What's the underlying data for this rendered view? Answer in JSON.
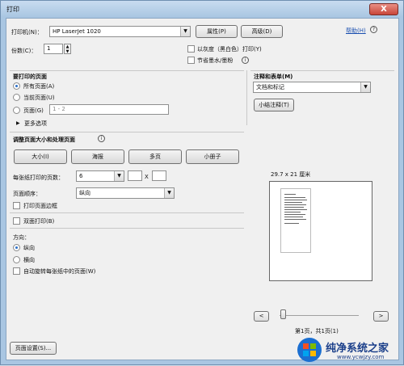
{
  "window": {
    "title": "打印",
    "close_label": "X"
  },
  "printer": {
    "label": "打印机(N)：",
    "selected": "HP LaserJet 1020",
    "properties_label": "属性(P)",
    "advanced_label": "高级(D)",
    "help_label": "帮助(H)",
    "help_icon": "?"
  },
  "copies": {
    "label": "份数(C)：",
    "value": "1"
  },
  "options": {
    "grayscale_label": "以灰度（黑白色）打印(Y)",
    "save_ink_label": "节省墨水/墨粉",
    "info_icon": "i"
  },
  "pages_section": {
    "title": "要打印的页面",
    "all_label": "所有页面(A)",
    "current_label": "当前页面(U)",
    "pages_label": "页面(G)",
    "pages_placeholder": "1 - 2",
    "more_label": "更多选项",
    "more_icon": "▶"
  },
  "comments_section": {
    "title": "注释和表单(M)",
    "selected": "文档和标记",
    "summarize_label": "小结注释(T)"
  },
  "sizing_section": {
    "title": "调整页面大小和处理页面",
    "info_icon": "i",
    "buttons": [
      "大小(I)",
      "海报",
      "多页",
      "小册子"
    ],
    "pages_per_sheet_label": "每张纸打印的页数：",
    "pages_per_sheet_value": "6",
    "x_label": "X",
    "page_order_label": "页面顺序：",
    "page_order_value": "纵向",
    "print_border_label": "打印页面边框"
  },
  "duplex": {
    "label": "双面打印(B)"
  },
  "orientation": {
    "title": "方向：",
    "portrait_label": "纵向",
    "landscape_label": "横向",
    "auto_rotate_label": "自动旋转每张纸中的页面(W)"
  },
  "preview": {
    "size_label": "29.7 x 21 厘米",
    "prev_icon": "<",
    "next_icon": ">",
    "page_status": "第1页，共1页(1)"
  },
  "footer": {
    "page_setup_label": "页面设置(S)..."
  },
  "watermark": {
    "text": "纯净系统之家",
    "url": "www.ycwjzy.com"
  },
  "colors": {
    "title_bar": "#a9c6e2",
    "client": "#f0f0f0",
    "accent": "#2a6fc9"
  }
}
